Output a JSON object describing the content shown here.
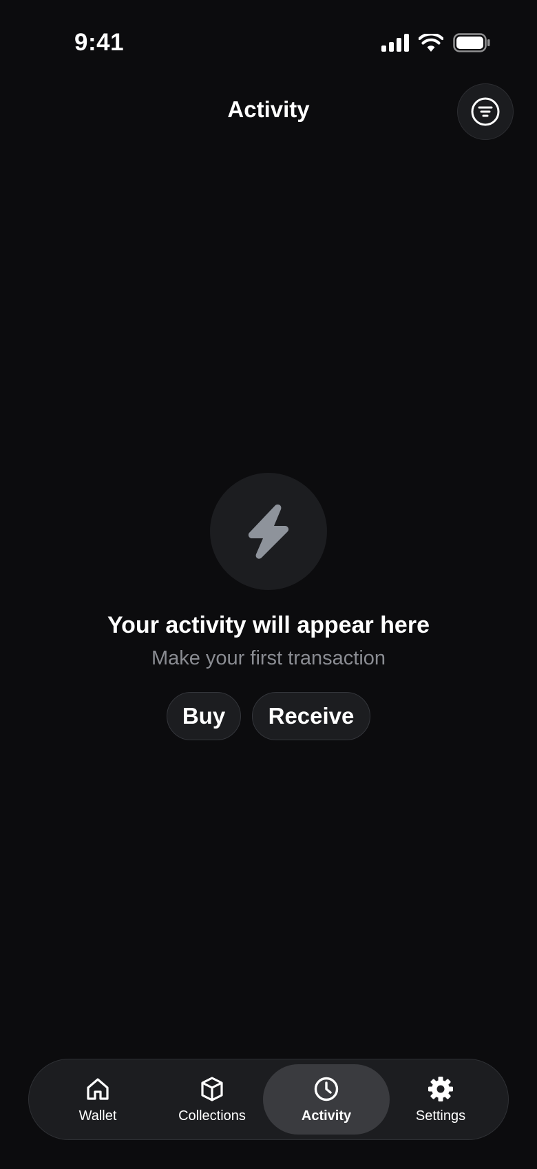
{
  "status_bar": {
    "time": "9:41",
    "icons": [
      "cellular-signal-icon",
      "wifi-icon",
      "battery-icon"
    ]
  },
  "header": {
    "title": "Activity",
    "filter_icon": "filter-icon"
  },
  "empty_state": {
    "icon": "lightning-bolt-icon",
    "title": "Your activity will appear here",
    "subtitle": "Make your first transaction",
    "actions": [
      {
        "label": "Buy"
      },
      {
        "label": "Receive"
      }
    ]
  },
  "tab_bar": {
    "tabs": [
      {
        "label": "Wallet",
        "icon": "home-icon",
        "active": false
      },
      {
        "label": "Collections",
        "icon": "cube-icon",
        "active": false
      },
      {
        "label": "Activity",
        "icon": "clock-icon",
        "active": true
      },
      {
        "label": "Settings",
        "icon": "gear-icon",
        "active": false
      }
    ]
  },
  "colors": {
    "background": "#0c0c0e",
    "surface": "#1c1d20",
    "active_tab": "#3a3b3f",
    "muted_text": "#8a8c92",
    "icon_muted": "#8e939b"
  }
}
